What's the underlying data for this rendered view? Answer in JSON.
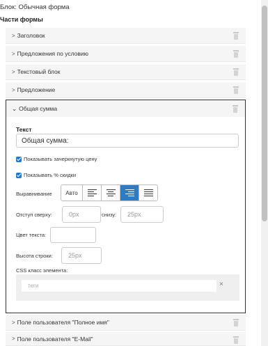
{
  "block_title": "Блок: Обычная форма",
  "section_title": "Части формы",
  "parts_top": [
    {
      "label": "Заголовок"
    },
    {
      "label": "Предложения по условию"
    },
    {
      "label": "Текстовый блок"
    },
    {
      "label": "Предложение"
    }
  ],
  "expanded": {
    "header_label": "Общая сумма",
    "text_label": "Текст",
    "text_value": "Общая сумма:",
    "checkbox_strikethrough": "Показывать зачеркнутую цену",
    "checkbox_discount": "Показывать % скидки",
    "alignment_label": "Выравнивание",
    "alignment_auto": "Авто",
    "offset_top_label": "Отступ сверху:",
    "offset_top_placeholder": "0px",
    "offset_bottom_label": "снизу:",
    "offset_bottom_placeholder": "25px",
    "text_color_label": "Цвет текста:",
    "line_height_label": "Высота строки:",
    "line_height_placeholder": "25px",
    "css_class_label": "CSS класс элемента:",
    "tags_placeholder": "теги",
    "tags_clear": "×"
  },
  "parts_bottom": [
    {
      "label": "Поле пользователя \"Полное имя\""
    },
    {
      "label": "Поле пользователя \"E-Mail\""
    }
  ],
  "icons": {
    "trash": "trash-icon",
    "chevron_right": "chevron-right-icon",
    "chevron_down": "chevron-down-icon"
  },
  "colors": {
    "accent": "#2d7bc4",
    "checkbox": "#1e78d6",
    "row_bg": "#f5f5f5"
  }
}
